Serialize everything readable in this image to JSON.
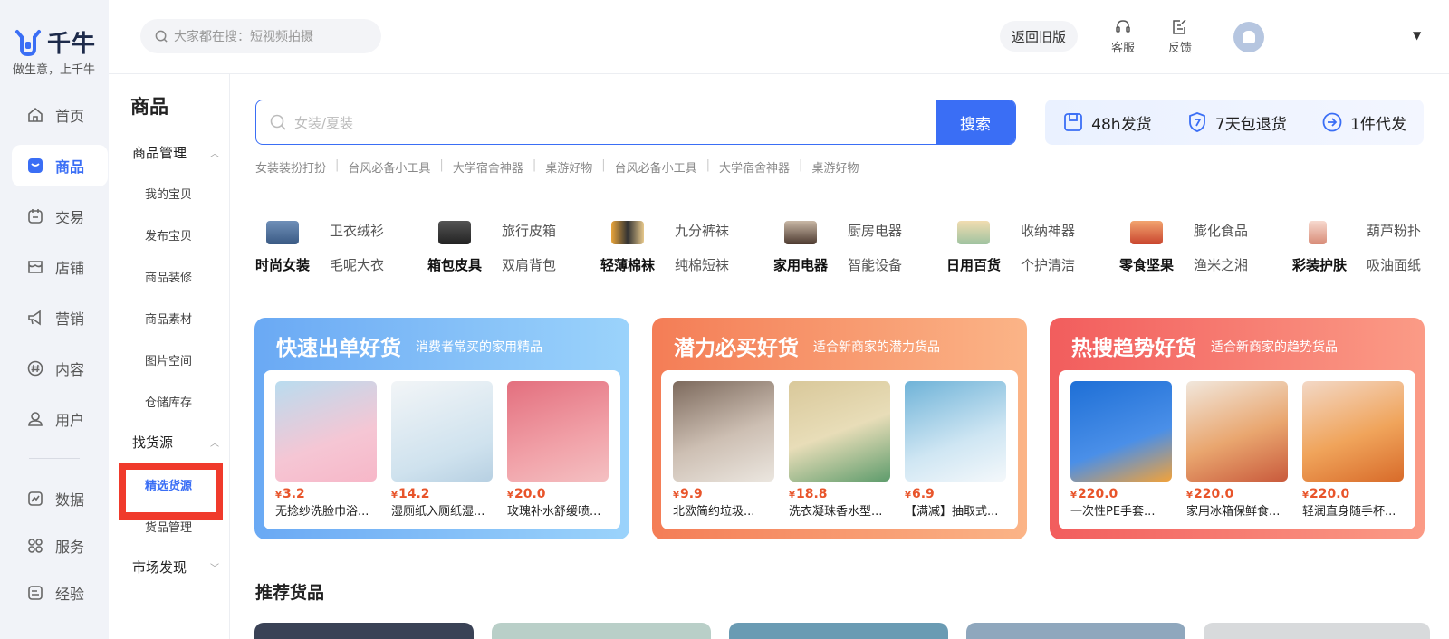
{
  "app": {
    "logo_text": "千牛",
    "slogan": "做生意，上千牛"
  },
  "nav": {
    "items": [
      {
        "label": "首页",
        "icon": "home-icon"
      },
      {
        "label": "商品",
        "icon": "product-icon",
        "active": true
      },
      {
        "label": "交易",
        "icon": "trade-icon"
      },
      {
        "label": "店铺",
        "icon": "shop-icon"
      },
      {
        "label": "营销",
        "icon": "megaphone-icon"
      },
      {
        "label": "内容",
        "icon": "content-icon"
      },
      {
        "label": "用户",
        "icon": "user-icon"
      },
      {
        "label": "数据",
        "icon": "chart-icon"
      },
      {
        "label": "服务",
        "icon": "grid-icon"
      },
      {
        "label": "经验",
        "icon": "book-icon"
      }
    ]
  },
  "subnav": {
    "title": "商品",
    "groups": [
      {
        "label": "商品管理",
        "items": [
          "我的宝贝",
          "发布宝贝",
          "商品装修",
          "商品素材",
          "图片空间",
          "仓储库存"
        ]
      },
      {
        "label": "找货源",
        "items": [
          "精选货源",
          "货品管理"
        ]
      },
      {
        "label": "市场发现",
        "items": []
      }
    ]
  },
  "header": {
    "search_placeholder": "大家都在搜：短视频拍摄",
    "old_version": "返回旧版",
    "service": "客服",
    "feedback": "反馈"
  },
  "search": {
    "placeholder": "女装/夏装",
    "button": "搜索",
    "hot_tags": [
      "女装装扮打扮",
      "台风必备小工具",
      "大学宿舍神器",
      "桌游好物",
      "台风必备小工具",
      "大学宿舍神器",
      "桌游好物"
    ]
  },
  "promises": [
    "48h发货",
    "7天包退货",
    "1件代发"
  ],
  "categories": [
    {
      "name": "时尚女装",
      "sub1": "卫衣绒衫",
      "sub2": "毛呢大衣"
    },
    {
      "name": "箱包皮具",
      "sub1": "旅行皮箱",
      "sub2": "双肩背包"
    },
    {
      "name": "轻薄棉袜",
      "sub1": "九分裤袜",
      "sub2": "纯棉短袜"
    },
    {
      "name": "家用电器",
      "sub1": "厨房电器",
      "sub2": "智能设备"
    },
    {
      "name": "日用百货",
      "sub1": "收纳神器",
      "sub2": "个护清洁"
    },
    {
      "name": "零食坚果",
      "sub1": "膨化食品",
      "sub2": "渔米之湘"
    },
    {
      "name": "彩装护肤",
      "sub1": "葫芦粉扑",
      "sub2": "吸油面纸"
    }
  ],
  "promos": [
    {
      "title": "快速出单好货",
      "subtitle": "消费者常买的家用精品",
      "products": [
        {
          "price": "3.2",
          "name": "无捻纱洗脸巾浴..."
        },
        {
          "price": "14.2",
          "name": "湿厕纸入厕纸湿..."
        },
        {
          "price": "20.0",
          "name": "玫瑰补水舒缓喷..."
        }
      ]
    },
    {
      "title": "潜力必买好货",
      "subtitle": "适合新商家的潜力货品",
      "products": [
        {
          "price": "9.9",
          "name": "北欧简约垃圾..."
        },
        {
          "price": "18.8",
          "name": "洗衣凝珠香水型..."
        },
        {
          "price": "6.9",
          "name": "【满减】抽取式..."
        }
      ]
    },
    {
      "title": "热搜趋势好货",
      "subtitle": "适合新商家的趋势货品",
      "products": [
        {
          "price": "220.0",
          "name": "一次性PE手套..."
        },
        {
          "price": "220.0",
          "name": "家用冰箱保鲜食..."
        },
        {
          "price": "220.0",
          "name": "轻润直身随手杯..."
        }
      ]
    }
  ],
  "currency": "¥",
  "recommend_title": "推荐货品"
}
